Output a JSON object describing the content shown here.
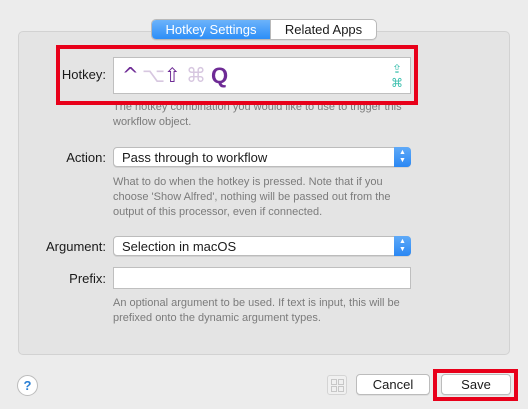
{
  "tabs": {
    "hotkey_settings": "Hotkey Settings",
    "related_apps": "Related Apps"
  },
  "hotkey": {
    "label": "Hotkey:",
    "keys": {
      "control": "^",
      "option": "⌥",
      "shift": "⇧",
      "command": "⌘",
      "key": "Q"
    },
    "caps_symbol": "⇪",
    "command_symbol": "⌘",
    "help": "The hotkey combination you would like to use to trigger this workflow object."
  },
  "action": {
    "label": "Action:",
    "value": "Pass through to workflow",
    "help": "What to do when the hotkey is pressed. Note that if you choose 'Show Alfred', nothing will be passed out from the output of this processor, even if connected."
  },
  "argument": {
    "label": "Argument:",
    "value": "Selection in macOS"
  },
  "prefix": {
    "label": "Prefix:",
    "value": "",
    "help": "An optional argument to be used. If text is input, this will be prefixed onto the dynamic argument types."
  },
  "buttons": {
    "help": "?",
    "cancel": "Cancel",
    "save": "Save"
  },
  "colors": {
    "highlight": "#e8001a",
    "accent": "#2c8ef8",
    "modifier_active": "#6e2b95",
    "caps_indicator": "#3cbfae"
  }
}
